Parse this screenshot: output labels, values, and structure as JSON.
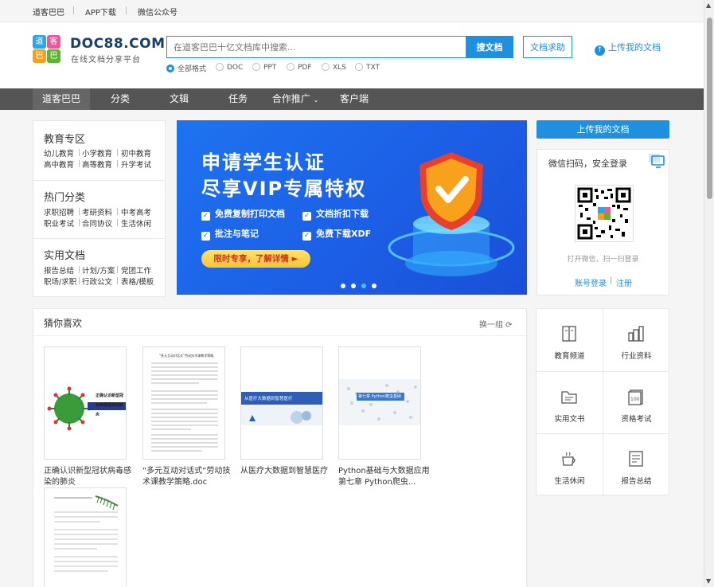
{
  "topbar": {
    "links": [
      "道客巴巴",
      "APP下载",
      "微信公众号"
    ]
  },
  "header": {
    "logo_text": "DOC88.COM",
    "logo_sub": "在线文档分享平台",
    "logo_glyphs": [
      "道",
      "客",
      "巴",
      "巴"
    ],
    "search_placeholder": "在道客巴巴十亿文档库中搜索...",
    "search_button": "搜文档",
    "help_button": "文档求助",
    "upload_link": "上传我的文档",
    "formats": [
      "全部格式",
      "DOC",
      "PPT",
      "PDF",
      "XLS",
      "TXT"
    ],
    "selected_format": "全部格式"
  },
  "nav": {
    "items": [
      "道客巴巴",
      "分类",
      "文辑",
      "任务",
      "合作推广",
      "客户端"
    ],
    "active": "道客巴巴"
  },
  "categories": [
    {
      "title": "教育专区",
      "links": [
        "幼儿教育",
        "小学教育",
        "初中教育",
        "高中教育",
        "高等教育",
        "升学考试"
      ]
    },
    {
      "title": "热门分类",
      "links": [
        "求职招聘",
        "考研资料",
        "中考高考",
        "职业考试",
        "合同协议",
        "生活休闲"
      ]
    },
    {
      "title": "实用文档",
      "links": [
        "报告总结",
        "计划/方案",
        "党团工作",
        "职场/求职",
        "行政公文",
        "表格/模板"
      ]
    }
  ],
  "banner": {
    "title1": "申请学生认证",
    "title2": "尽享VIP专属特权",
    "features": [
      "免费复制打印文档",
      "文档折扣下载",
      "批注与笔记",
      "免费下载XDF"
    ],
    "promo": "限时专享，了解详情 ►",
    "slide_count": 4,
    "active_slide": 3
  },
  "right": {
    "upload_button": "上传我的文档",
    "login_title": "微信扫码，安全登录",
    "login_hint": "打开微信，扫一扫登录",
    "account_login": "账号登录",
    "register": "注册"
  },
  "guess": {
    "title": "猜你喜欢",
    "refresh": "换一组 ⟳",
    "docs": [
      {
        "title": "正确认识新型冠状病毒感染的肺炎",
        "thumb_heading": "正确认识新型冠状病毒感染的肺炎"
      },
      {
        "title": "“多元互动对话式”劳动技术课教学策略.doc",
        "thumb_heading": "“多元互动对话式”劳动技术课教学策略"
      },
      {
        "title": "从医疗大数据到智慧医疗",
        "thumb_heading": "从医疗大数据到智慧医疗"
      },
      {
        "title": "Python基础与大数据应用 第七章 Python爬虫...",
        "thumb_heading": "第七章 Python爬虫基础"
      },
      {
        "title": "",
        "thumb_heading": ""
      }
    ]
  },
  "grid": {
    "items": [
      "教育频道",
      "行业资料",
      "实用文书",
      "资格考试",
      "生活休闲",
      "报告总结"
    ]
  },
  "colors": {
    "accent": "#1f8fe0",
    "nav_bg": "#555555",
    "banner": "#1e6be8"
  }
}
